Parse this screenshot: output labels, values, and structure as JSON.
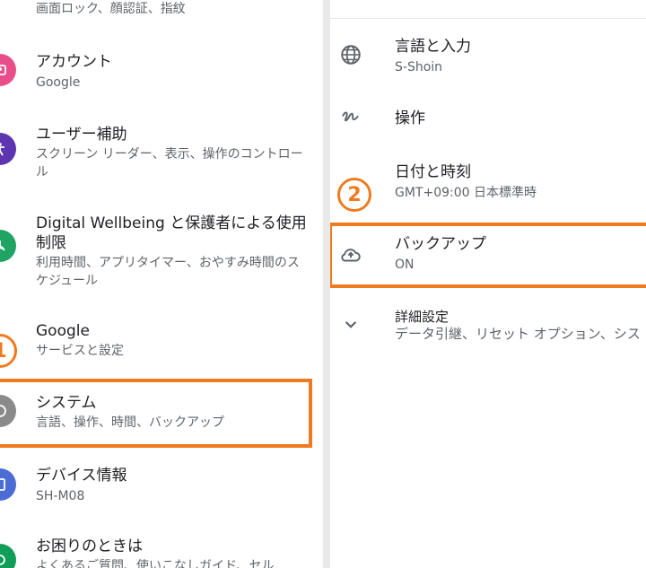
{
  "left": {
    "top_partial_subtitle": "画面ロック、顔認証、指紋",
    "items": [
      {
        "title": "アカウント",
        "subtitle": "Google",
        "icon": "account-icon",
        "color": "#e84f8a"
      },
      {
        "title": "ユーザー補助",
        "subtitle": "スクリーン リーダー、表示、操作のコントロール",
        "icon": "accessibility-icon",
        "color": "#5e35b1"
      },
      {
        "title": "Digital Wellbeing と保護者による使用制限",
        "subtitle": "利用時間、アプリタイマー、おやすみ時間のスケジュール",
        "icon": "wellbeing-icon",
        "color": "#1fa463"
      },
      {
        "title": "Google",
        "subtitle": "サービスと設定",
        "icon": "google-icon",
        "color": "#4285f4"
      },
      {
        "title": "システム",
        "subtitle": "言語、操作、時間、バックアップ",
        "icon": "system-icon",
        "color": "#8a8a8a"
      },
      {
        "title": "デバイス情報",
        "subtitle": "SH-M08",
        "icon": "device-info-icon",
        "color": "#4a6cd4"
      },
      {
        "title": "お困りのときは",
        "subtitle": "よくあるご質問、使いこなしガイド、セル",
        "icon": "help-icon",
        "color": "#0f9d58"
      }
    ],
    "step_number": "1"
  },
  "right": {
    "items": [
      {
        "title": "言語と入力",
        "subtitle": "S-Shoin",
        "icon": "globe-icon"
      },
      {
        "title": "操作",
        "subtitle": "",
        "icon": "gesture-icon"
      },
      {
        "title": "日付と時刻",
        "subtitle": "GMT+09:00 日本標準時",
        "icon": "clock-icon"
      },
      {
        "title": "バックアップ",
        "subtitle": "ON",
        "icon": "cloud-upload-icon"
      },
      {
        "title": "詳細設定",
        "subtitle": "データ引継、リセット オプション、シス",
        "icon": "chevron-down-icon"
      }
    ],
    "step_number": "2"
  },
  "highlight_color": "#f07a1e"
}
